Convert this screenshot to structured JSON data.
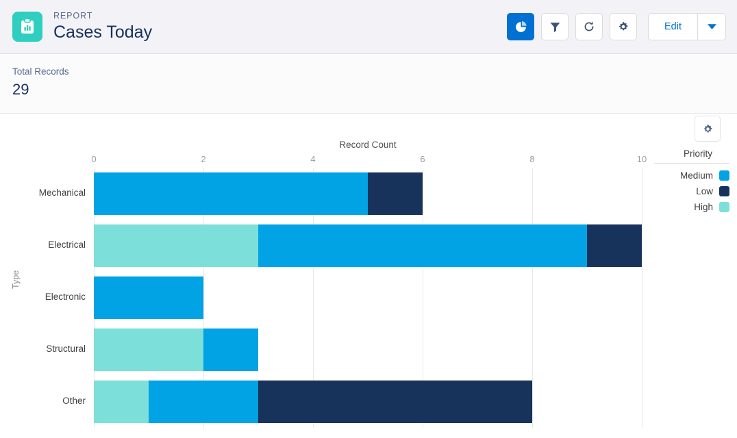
{
  "header": {
    "eyebrow": "REPORT",
    "title": "Cases Today",
    "app_icon": "report-clipboard-icon",
    "toolbar": {
      "chart_toggle": {
        "icon": "pie-chart-icon",
        "active": true
      },
      "filter": {
        "icon": "filter-funnel-icon"
      },
      "refresh": {
        "icon": "refresh-icon"
      },
      "settings": {
        "icon": "gear-icon"
      },
      "edit_label": "Edit",
      "edit_caret": "caret-down-icon"
    }
  },
  "summary": {
    "label": "Total Records",
    "value": "29"
  },
  "chart_settings_icon": "gear-icon",
  "chart_data": {
    "type": "bar",
    "orientation": "horizontal",
    "stacked": true,
    "title": "",
    "xlabel": "Record Count",
    "ylabel": "Type",
    "categories": [
      "Mechanical",
      "Electrical",
      "Electronic",
      "Structural",
      "Other"
    ],
    "xlim": [
      0,
      10
    ],
    "xticks": [
      0,
      2,
      4,
      6,
      8,
      10
    ],
    "xtick_labels": [
      "0",
      "2",
      "4",
      "6",
      "8",
      "10"
    ],
    "grid": true,
    "legend_position": "right",
    "legend_title": "Priority",
    "series": [
      {
        "name": "High",
        "color": "#7ddfd9",
        "values": [
          0,
          3,
          0,
          2,
          1
        ]
      },
      {
        "name": "Medium",
        "color": "#02a3e4",
        "values": [
          5,
          6,
          2,
          1,
          2
        ]
      },
      {
        "name": "Low",
        "color": "#17325b",
        "values": [
          1,
          1,
          0,
          0,
          5
        ]
      }
    ],
    "stack_order": [
      "High",
      "Medium",
      "Low"
    ],
    "totals": [
      6,
      10,
      2,
      3,
      8
    ],
    "legend_entries": [
      {
        "label": "Medium",
        "color": "#02a3e4"
      },
      {
        "label": "Low",
        "color": "#17325b"
      },
      {
        "label": "High",
        "color": "#7ddfd9"
      }
    ]
  },
  "colors": {
    "brand_blue": "#0070d2",
    "icon_teal": "#2ecfc0",
    "title_navy": "#16325c"
  }
}
